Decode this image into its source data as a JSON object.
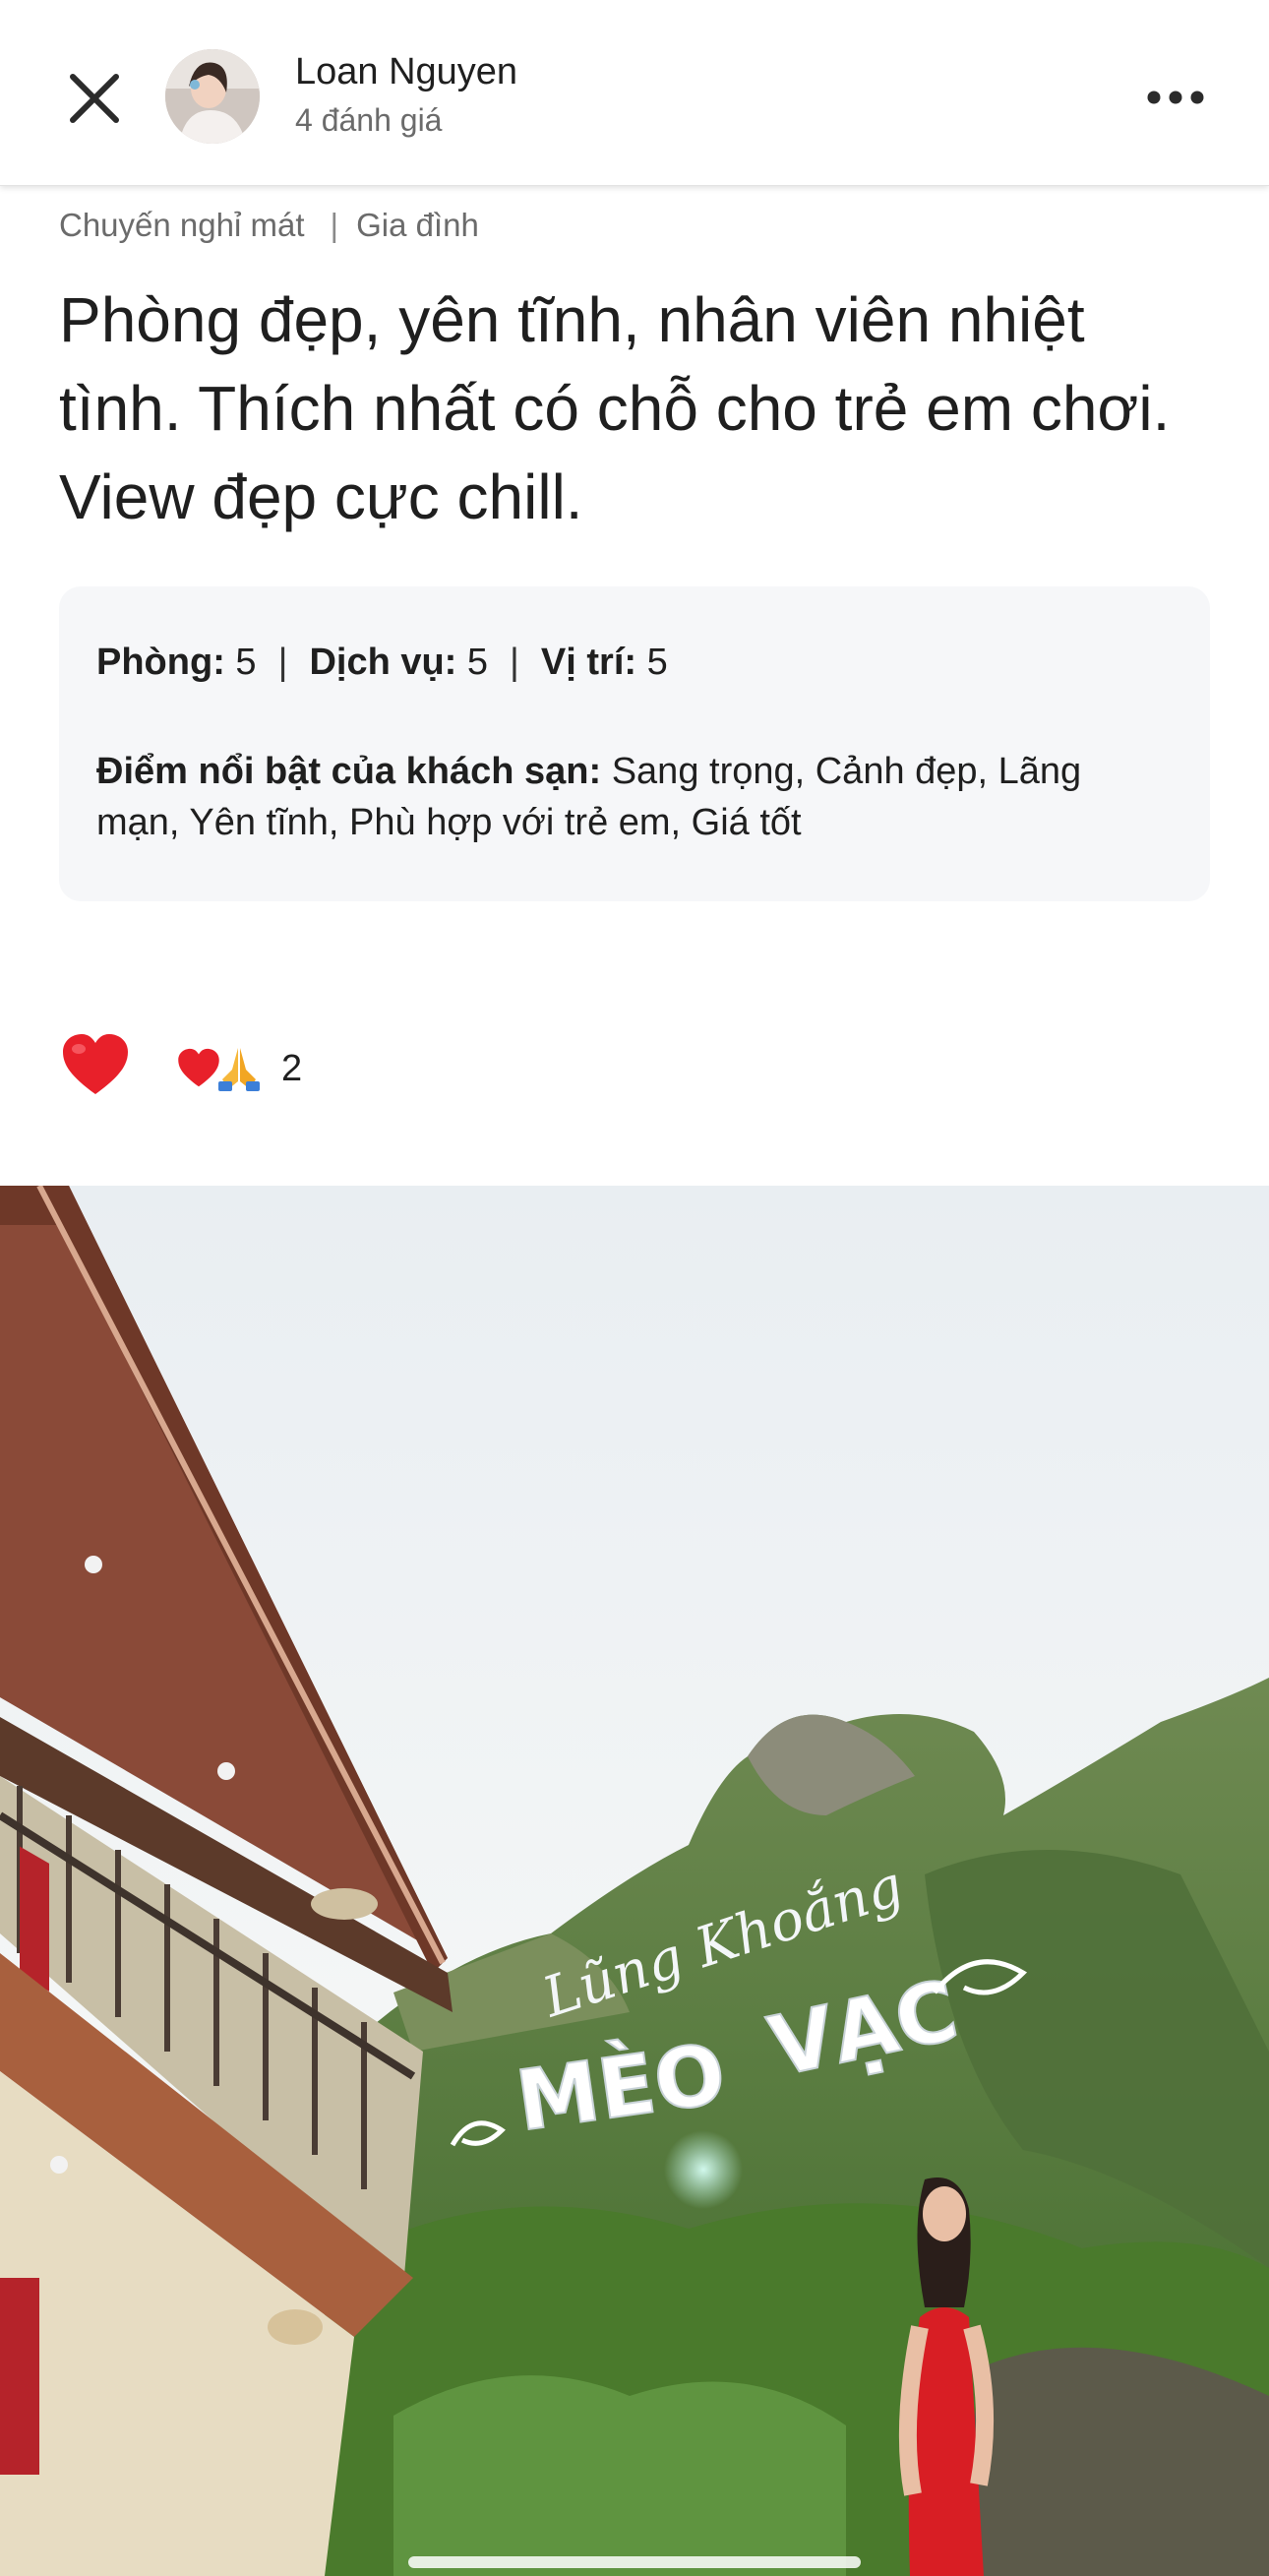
{
  "header": {
    "user_name": "Loan Nguyen",
    "review_count": "4 đánh giá",
    "close_icon": "close-icon",
    "more_icon": "more-horizontal-icon"
  },
  "review": {
    "tags": [
      "Chuyến nghỉ mát",
      "Gia đình"
    ],
    "title": "Phòng đẹp, yên tĩnh, nhân viên nhiệt tình. Thích nhất có chỗ cho trẻ em chơi. View đẹp cực chill.",
    "scores": [
      {
        "label": "Phòng:",
        "value": "5"
      },
      {
        "label": "Dịch vụ:",
        "value": "5"
      },
      {
        "label": "Vị trí:",
        "value": "5"
      }
    ],
    "highlights_label": "Điểm nổi bật của khách sạn:",
    "highlights_value": "Sang trọng, Cảnh đẹp, Lãng mạn, Yên tĩnh, Phù hợp với trẻ em, Giá tốt"
  },
  "reactions": {
    "like_icon": "heart-icon",
    "summary_icons": [
      "heart-icon",
      "folded-hands-icon"
    ],
    "count": "2"
  },
  "photo": {
    "sign_script": "Lũng Khoắng",
    "sign_letters": [
      "MÈO",
      "VẠC"
    ]
  },
  "colors": {
    "heart": "#e8202a",
    "text_primary": "#1f1f1f",
    "text_secondary": "#6b6b6b",
    "card_bg": "#f6f7f9",
    "dress": "#d81e24"
  }
}
